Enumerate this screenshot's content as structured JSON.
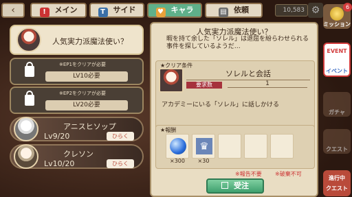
{
  "top": {
    "back_icon": "back-arrow-icon",
    "tabs": [
      {
        "label": "メイン",
        "icon": "!"
      },
      {
        "label": "サイド",
        "icon": "T"
      },
      {
        "label": "キャラ",
        "icon": "♥"
      },
      {
        "label": "依頼",
        "icon": "▤"
      }
    ],
    "gauge": "10,583"
  },
  "quest_list": {
    "active": {
      "title": "人気実力派魔法使い？"
    },
    "locked": [
      {
        "note": "※EP1をクリアが必要",
        "req": "LV10必要"
      },
      {
        "note": "※EP2をクリアが必要",
        "req": "LV20必要"
      }
    ],
    "characters": [
      {
        "name": "アニスヒソップ",
        "level": "Lv9/20",
        "button": "ひらく"
      },
      {
        "name": "クレソン",
        "level": "Lv10/20",
        "button": "ひらく"
      }
    ]
  },
  "detail": {
    "title": "人気実力派魔法使い？",
    "description": "暇を持て余した「ソレル」は退屈を紛らわせられる事件を探しているようだ…",
    "clear_label": "クリア条件",
    "target": "ソレルと会話",
    "req_label": "要求数",
    "req_value": "1",
    "clear_desc": "アカデミーにいる「ソレル」に話しかける",
    "reward_label": "報酬",
    "rewards": [
      {
        "count": "×300",
        "icon": "blue-orb-icon"
      },
      {
        "count": "×30",
        "icon": "crown-icon"
      }
    ],
    "warn1": "※報告不要",
    "warn2": "※破棄不可",
    "accept": "受注"
  },
  "sidebar": {
    "mission": {
      "label": "ミッション",
      "badge": "6"
    },
    "event": {
      "label": "イベント",
      "tag": "EVENT"
    },
    "gacha": {
      "label": "ガチャ"
    },
    "quest": {
      "label": "クエスト"
    },
    "inprogress": {
      "label1": "進行中",
      "label2": "クエスト"
    }
  }
}
